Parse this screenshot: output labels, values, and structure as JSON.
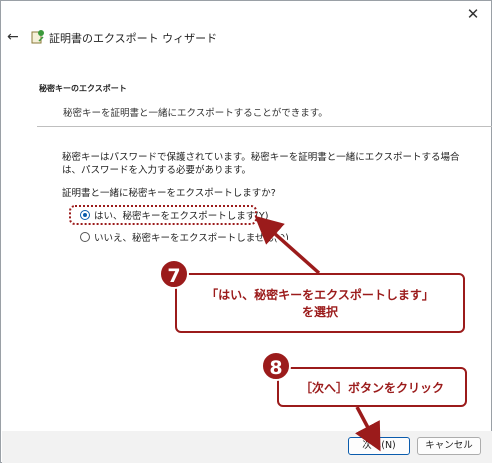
{
  "window": {
    "title": "証明書のエクスポート ウィザード",
    "close_glyph": "✕",
    "back_glyph": "←"
  },
  "header": {
    "title": "秘密キーのエクスポート",
    "description": "秘密キーを証明書と一緒にエクスポートすることができます。"
  },
  "main": {
    "body_text": "秘密キーはパスワードで保護されています。秘密キーを証明書と一緒にエクスポートする場合は、パスワードを入力する必要があります。",
    "question": "証明書と一緒に秘密キーをエクスポートしますか?",
    "options": [
      {
        "label": "はい、秘密キーをエクスポートします(Y)",
        "selected": true
      },
      {
        "label": "いいえ、秘密キーをエクスポートしません(O)",
        "selected": false
      }
    ]
  },
  "annotations": {
    "step7": {
      "number": "7",
      "line1": "「はい、秘密キーをエクスポートします」",
      "line2": "を選択"
    },
    "step8": {
      "number": "8",
      "text": "［次へ］ボタンをクリック"
    },
    "accent_color": "#9b1b1b"
  },
  "footer": {
    "next_label": "次へ(N)",
    "cancel_label": "キャンセル"
  }
}
